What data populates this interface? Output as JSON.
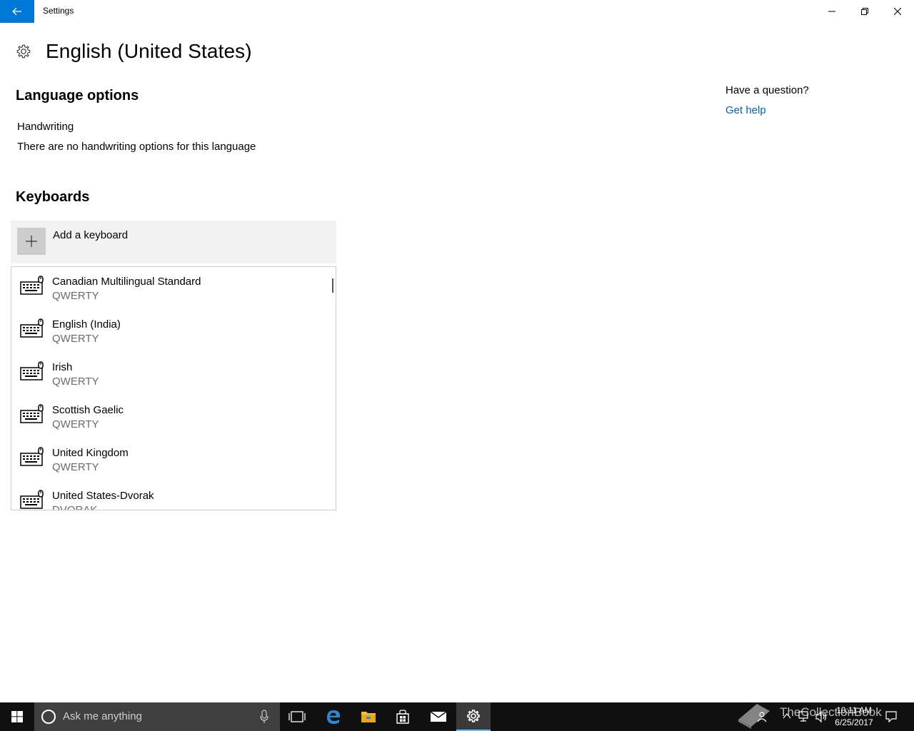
{
  "window": {
    "title": "Settings"
  },
  "page": {
    "title": "English (United States)"
  },
  "language_options": {
    "heading": "Language options",
    "handwriting_label": "Handwriting",
    "handwriting_note": "There are no handwriting options for this language"
  },
  "keyboards": {
    "heading": "Keyboards",
    "add_label": "Add a keyboard",
    "items": [
      {
        "name": "Canadian Multilingual Standard",
        "layout": "QWERTY"
      },
      {
        "name": "English (India)",
        "layout": "QWERTY"
      },
      {
        "name": "Irish",
        "layout": "QWERTY"
      },
      {
        "name": "Scottish Gaelic",
        "layout": "QWERTY"
      },
      {
        "name": "United Kingdom",
        "layout": "QWERTY"
      },
      {
        "name": "United States-Dvorak",
        "layout": "DVORAK"
      }
    ]
  },
  "help": {
    "question": "Have a question?",
    "link": "Get help"
  },
  "taskbar": {
    "search_placeholder": "Ask me anything",
    "time": "10:11 AM",
    "date": "6/25/2017",
    "watermark": "TheCollectionBook"
  },
  "icons": {
    "back": "back-arrow-icon",
    "gear": "gear-icon",
    "plus": "plus-icon",
    "keyboard": "keyboard-icon"
  },
  "colors": {
    "accent": "#0078d7",
    "link": "#0063b1",
    "taskbar": "#101010"
  }
}
